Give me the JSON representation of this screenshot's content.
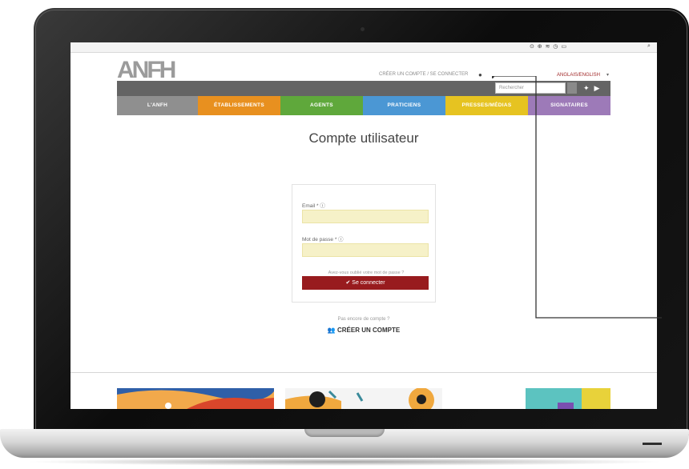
{
  "browser": {
    "menubar_icons": "⊙ ⊕ ≋ ◷ ▭",
    "menubar_search": "⌕"
  },
  "site": {
    "logo": "ANFH",
    "account_link": "CRÉER UN COMPTE / SE CONNECTER",
    "language": "ANGLAIS/ENGLISH",
    "search_placeholder": "Rechercher",
    "nav": [
      {
        "label": "L'ANFH",
        "color": "#8f8f8f"
      },
      {
        "label": "ÉTABLISSEMENTS",
        "color": "#e8901f"
      },
      {
        "label": "AGENTS",
        "color": "#5fa83b"
      },
      {
        "label": "PRATICIENS",
        "color": "#4b97d4"
      },
      {
        "label": "PRESSES/MÉDIAS",
        "color": "#e6c321"
      },
      {
        "label": "SIGNATAIRES",
        "color": "#9d7ab8"
      }
    ]
  },
  "page": {
    "title": "Compte utilisateur"
  },
  "login": {
    "email_label": "Email * ⓘ",
    "password_label": "Mot de passe * ⓘ",
    "forgot": "Avez-vous oublié votre mot de passe ?",
    "submit": "✔ Se connecter"
  },
  "signup": {
    "prompt": "Pas encore de compte ?",
    "link": "👥 CRÉER UN COMPTE"
  },
  "colors": {
    "brand_red": "#981b1e",
    "input_fill": "#f6f1c8",
    "dark_bar": "#646464"
  }
}
